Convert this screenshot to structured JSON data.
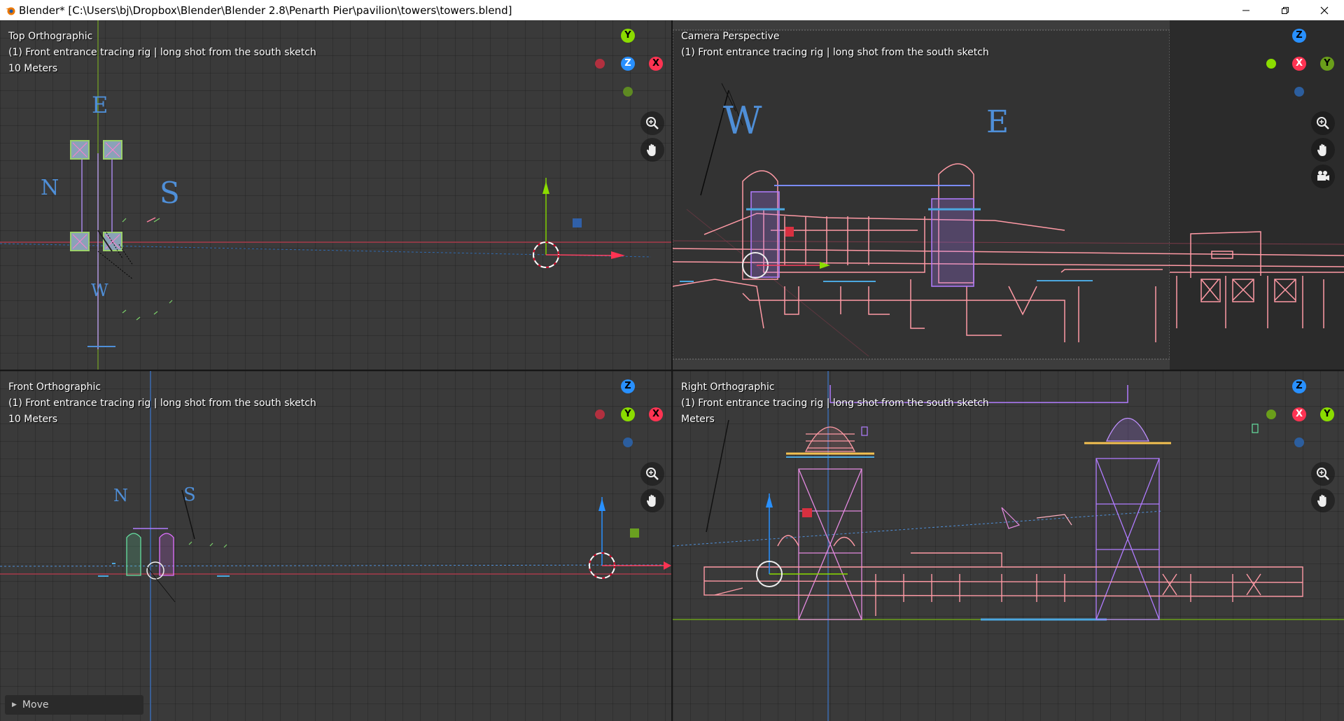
{
  "window": {
    "title": "Blender* [C:\\Users\\bj\\Dropbox\\Blender\\Blender 2.8\\Penarth Pier\\pavilion\\towers\\towers.blend]",
    "controls": [
      "minimize-icon",
      "restore-icon",
      "close-icon"
    ]
  },
  "viewports": {
    "top": {
      "view_name": "Top Orthographic",
      "collection": "(1) Front entrance tracing rig | long shot from the south sketch",
      "scale": "10 Meters",
      "gizmo_axes": {
        "up": "Y",
        "center": "Z",
        "right": "X"
      }
    },
    "camera": {
      "view_name": "Camera Perspective",
      "collection": "(1) Front entrance tracing rig | long shot from the south sketch",
      "gizmo_axes": {
        "up": "Z",
        "center": "X",
        "right": "Y"
      }
    },
    "front": {
      "view_name": "Front Orthographic",
      "collection": "(1) Front entrance tracing rig | long shot from the south sketch",
      "scale": "10 Meters",
      "gizmo_axes": {
        "up": "Z",
        "center": "Y",
        "right": "X"
      }
    },
    "right": {
      "view_name": "Right Orthographic",
      "collection": "(1) Front entrance tracing rig | long shot from the south sketch",
      "scale": "Meters",
      "gizmo_axes": {
        "up": "Z",
        "center": "X",
        "right": "Y"
      }
    }
  },
  "sketch_letters": {
    "top": {
      "east": "E",
      "north": "N",
      "south": "S",
      "west": "W"
    },
    "camera": {
      "west": "W",
      "east": "E"
    },
    "front": {
      "north": "N",
      "south": "S"
    }
  },
  "operator_panel": {
    "label": "Move"
  },
  "colors": {
    "axis_x": "#ff3352",
    "axis_y": "#8bdc00",
    "axis_z": "#2890ff",
    "sketch_pink": "#ff9aa5",
    "sketch_purple": "#b17cff",
    "sketch_blue": "#4f8fd8"
  }
}
